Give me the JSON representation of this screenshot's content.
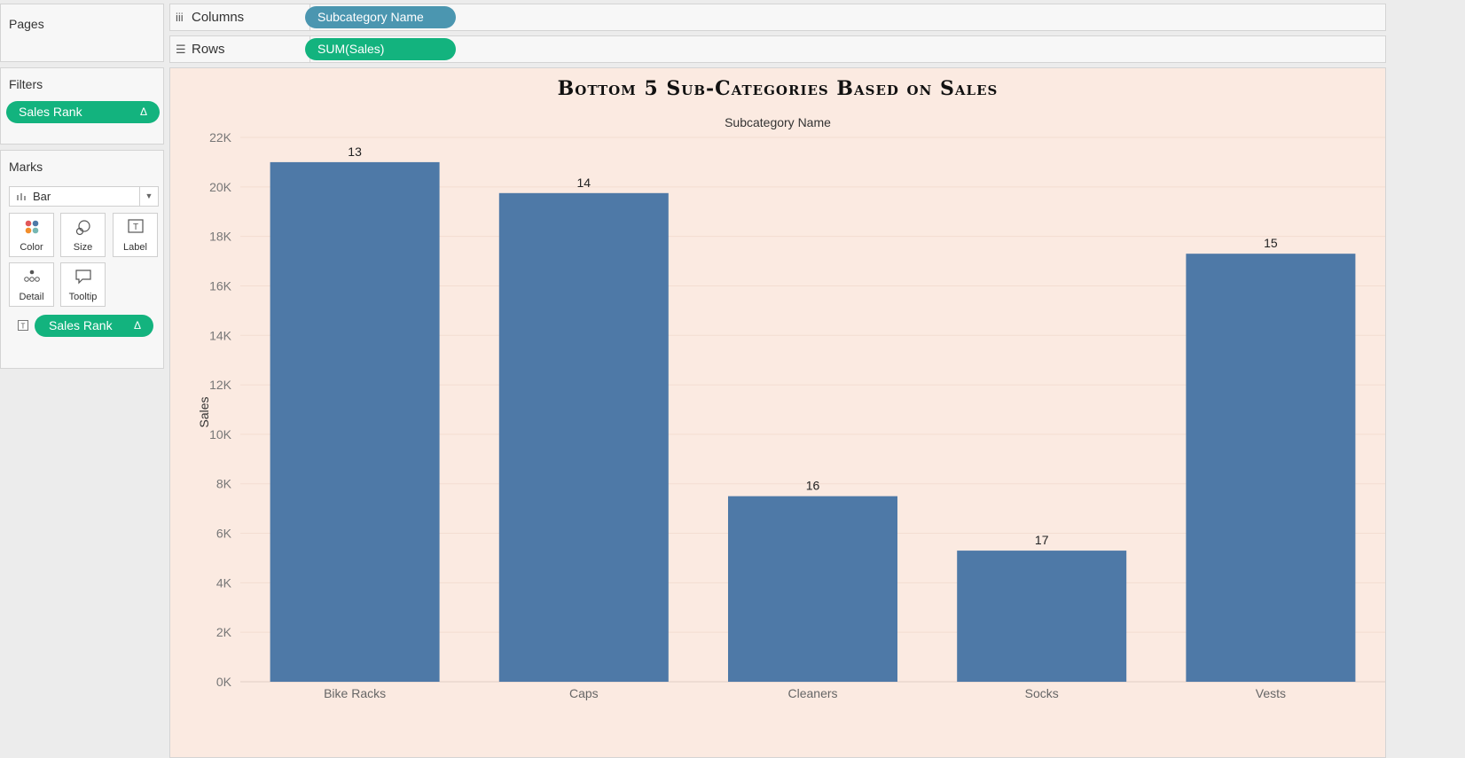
{
  "pages": {
    "title": "Pages"
  },
  "columns_shelf": {
    "label": "Columns",
    "icon": "columns-icon",
    "pill": "Subcategory Name"
  },
  "rows_shelf": {
    "label": "Rows",
    "icon": "rows-icon",
    "pill": "SUM(Sales)"
  },
  "filters": {
    "title": "Filters",
    "pill": "Sales Rank",
    "pill_icon": "delta-icon"
  },
  "marks": {
    "title": "Marks",
    "type": "Bar",
    "buttons": [
      {
        "label": "Color",
        "icon": "color-icon"
      },
      {
        "label": "Size",
        "icon": "size-icon"
      },
      {
        "label": "Label",
        "icon": "label-icon"
      },
      {
        "label": "Detail",
        "icon": "detail-icon"
      },
      {
        "label": "Tooltip",
        "icon": "tooltip-icon"
      }
    ],
    "pill": "Sales Rank",
    "pill_icon": "delta-icon"
  },
  "colors": {
    "bar": "#4e79a7",
    "green_pill": "#13b37e",
    "blue_pill": "#4b96b0",
    "chart_bg": "#fbeae1"
  },
  "chart_data": {
    "type": "bar",
    "title": "Bottom 5 Sub-Categories Based on Sales",
    "xlabel": "Subcategory Name",
    "ylabel": "Sales",
    "categories": [
      "Bike Racks",
      "Caps",
      "Cleaners",
      "Socks",
      "Vests"
    ],
    "values": [
      21000,
      19750,
      7500,
      5300,
      17300
    ],
    "data_labels": [
      "13",
      "14",
      "16",
      "17",
      "15"
    ],
    "ylim": [
      0,
      22000
    ],
    "yticks": [
      0,
      2000,
      4000,
      6000,
      8000,
      10000,
      12000,
      14000,
      16000,
      18000,
      20000,
      22000
    ],
    "ytick_labels": [
      "0K",
      "2K",
      "4K",
      "6K",
      "8K",
      "10K",
      "12K",
      "14K",
      "16K",
      "18K",
      "20K",
      "22K"
    ],
    "grid": true
  }
}
